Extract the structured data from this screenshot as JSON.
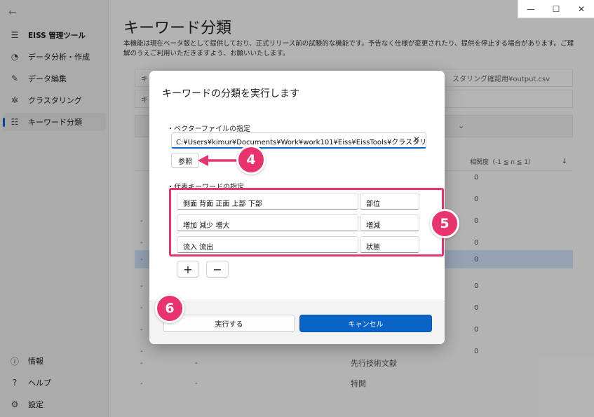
{
  "window": {
    "minimize": "—",
    "maximize": "☐",
    "close": "✕"
  },
  "sidebar": {
    "app_title": "EISS 管理ツール",
    "items": [
      {
        "label": "データ分析・作成",
        "icon": "chart-pie-icon"
      },
      {
        "label": "データ編集",
        "icon": "pencil-icon"
      },
      {
        "label": "クラスタリング",
        "icon": "cluster-icon"
      },
      {
        "label": "キーワード分類",
        "icon": "list-icon"
      }
    ],
    "bottom_items": [
      {
        "label": "情報",
        "icon": "info-icon"
      },
      {
        "label": "ヘルプ",
        "icon": "help-icon"
      },
      {
        "label": "設定",
        "icon": "gear-icon"
      }
    ]
  },
  "main": {
    "title": "キーワード分類",
    "notice": "本機能は現在ベータ版として提供しており、正式リリース前の試験的な機能です。予告なく仕様が変更されたり、提供を停止する場合があります。ご理解のうえご利用いただきますよう、お願いいたします。",
    "bg_box1_text": "キ",
    "bg_box1_right": "スタリング確認用¥output.csv",
    "bg_box2_text": "キ",
    "bg_col_header": "相関度（-1 ≦ n ≦ 1）",
    "rows": [
      {
        "left": "",
        "right": "0",
        "mid": ""
      },
      {
        "left": "",
        "right": "0",
        "mid": ""
      },
      {
        "left": "-",
        "right": "0",
        "mid": ""
      },
      {
        "left": "-",
        "right": "0",
        "mid": ""
      },
      {
        "left": "-",
        "right": "0",
        "mid": ""
      },
      {
        "left": "-",
        "right": "0",
        "mid": ""
      },
      {
        "left": "-",
        "right": "0",
        "mid": ""
      },
      {
        "left": "-",
        "right": "0",
        "mid": ""
      },
      {
        "left": "-",
        "right": "0",
        "mid": ""
      },
      {
        "left": "-",
        "right": "",
        "mid": "先行技術文献"
      },
      {
        "left": "-",
        "right": "",
        "mid": "特開"
      }
    ]
  },
  "dialog": {
    "title": "キーワードの分類を実行します",
    "vector_label": "・ベクターファイルの指定",
    "vector_path": "C:¥Users¥kimur¥Documents¥Work¥work101¥Eiss¥EissTools¥クラスタリ",
    "browse_label": "参照",
    "keywords_label": "・代表キーワードの指定",
    "keywords": [
      {
        "words": "側面 背面 正面 上部 下部",
        "name": "部位"
      },
      {
        "words": "増加 減少 増大",
        "name": "増減"
      },
      {
        "words": "流入 流出",
        "name": "状態"
      }
    ],
    "add_label": "+",
    "remove_label": "−",
    "run_label": "実行する",
    "cancel_label": "キャンセル"
  },
  "annotations": {
    "badge4": "4",
    "badge5": "5",
    "badge6": "6",
    "accent": "#e8336d"
  }
}
